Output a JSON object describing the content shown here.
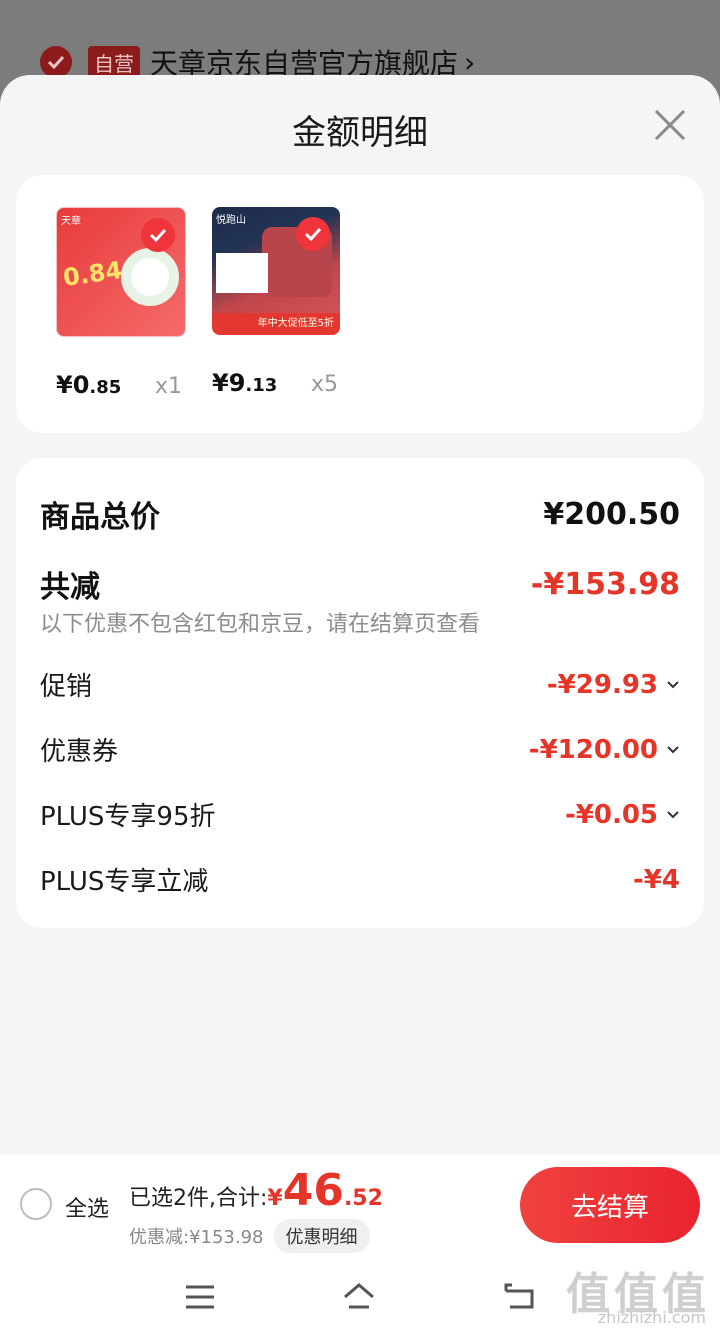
{
  "store": {
    "badge": "自营",
    "name": "天章京东自营官方旗舰店",
    "chevron": "›"
  },
  "sheet": {
    "title": "金额明细"
  },
  "products": [
    {
      "price_int": "¥0",
      "price_dec": ".85",
      "qty": "x1",
      "thumb_tag": "天章",
      "thumb_big": "0.84"
    },
    {
      "price_int": "¥9",
      "price_dec": ".13",
      "qty": "x5",
      "thumb_tag": "悦跑山",
      "thumb_strip": "年中大促低至5折"
    }
  ],
  "summary": {
    "total_label": "商品总价",
    "total_value": "¥200.50",
    "reduce_label": "共减",
    "reduce_value": "-¥153.98",
    "note": "以下优惠不包含红包和京豆，请在结算页查看",
    "items": [
      {
        "label": "促销",
        "value": "-¥29.93"
      },
      {
        "label": "优惠券",
        "value": "-¥120.00"
      },
      {
        "label": "PLUS专享95折",
        "value": "-¥0.05"
      },
      {
        "label": "PLUS专享立减",
        "value": "-¥4"
      }
    ]
  },
  "bottom": {
    "select_all": "全选",
    "selected_prefix": "已选2件,合计:",
    "yen": "¥",
    "total_int": "46",
    "total_dec": ".52",
    "discount": "优惠减:¥153.98",
    "detail_button": "优惠明细",
    "checkout": "去结算"
  },
  "watermark": {
    "main": "值值值",
    "sub": "zhizhizhi.com"
  },
  "colors": {
    "accent_red": "#e53528",
    "check_red": "#f0343b"
  }
}
